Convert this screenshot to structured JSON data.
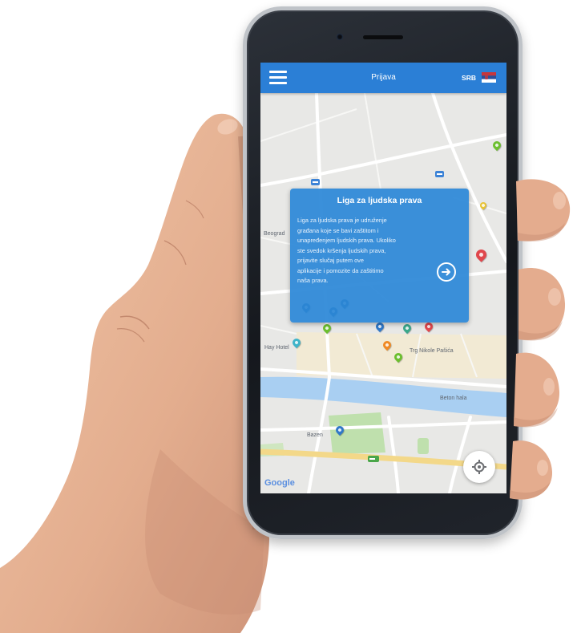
{
  "app": {
    "title": "Prijava",
    "language": "SRB"
  },
  "dialog": {
    "title": "Liga za ljudska prava",
    "body": [
      "Liga za ljudska prava je udruženje",
      "građana koje se bavi zaštitom i",
      "unapređenjem ljudskih prava. Ukoliko",
      "ste svedok kršenja ljudskih prava,",
      "prijavite slučaj putem ove",
      "aplikacije i pomozite da zaštitimo",
      "naša prava."
    ]
  },
  "map": {
    "labels": {
      "city": "Beograd",
      "hotel": "Hay Hotel",
      "square": "Trg Nikole Pašića",
      "riverbank": "Beton hala",
      "pool": "Bazen"
    },
    "attribution": "Google"
  },
  "icons": {
    "menu": "hamburger-icon",
    "language_flag": "flag-icon",
    "next": "arrow-right-icon",
    "locate": "crosshair-icon",
    "markers": "map-marker-icon",
    "transit": "transit-icon"
  },
  "colors": {
    "app_bar": "#2b7fd6",
    "dialog": "#2c88d7",
    "map_background": "#e8e8e6",
    "river": "#a9cff2",
    "park": "#bfe0ad",
    "main_road": "#f3d889",
    "marker_green": "#6cbf2e",
    "marker_red": "#e0474c",
    "marker_blue": "#2f78c8",
    "marker_orange": "#f08a24",
    "skin": "#e4ac8e",
    "phone_body": "#1d2026"
  }
}
